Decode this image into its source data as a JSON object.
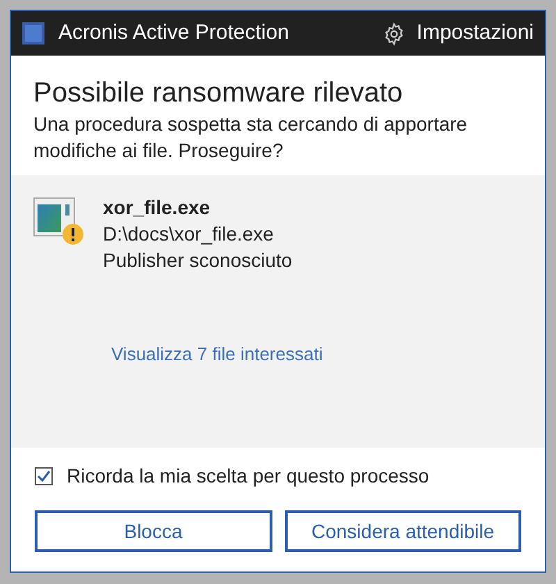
{
  "window": {
    "title": "Acronis Active Protection",
    "settings": "Impostazioni"
  },
  "header": {
    "title": "Possibile ransomware rilevato",
    "message": "Una procedura sospetta sta cercando di apportare modifiche ai file. Proseguire?"
  },
  "process": {
    "name": "xor_file.exe",
    "path": "D:\\docs\\xor_file.exe",
    "publisher": "Publisher sconosciuto",
    "warning": true
  },
  "link": "Visualizza 7 file interessati",
  "remember": {
    "label": "Ricorda la mia scelta per questo processo",
    "checked": true
  },
  "buttons": [
    "Blocca",
    "Considera attendibile"
  ]
}
